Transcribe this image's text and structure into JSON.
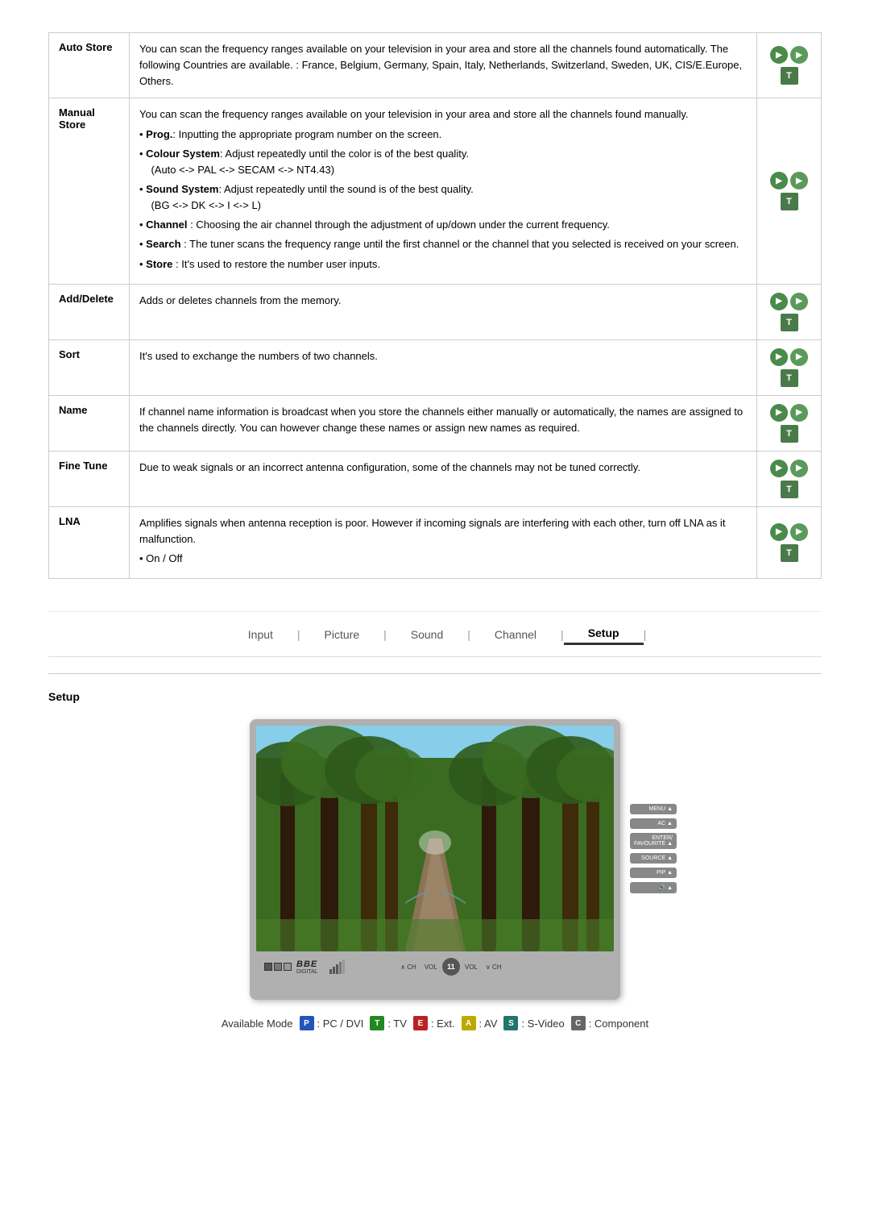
{
  "table": {
    "rows": [
      {
        "label": "Auto Store",
        "description": "You can scan the frequency ranges available on your television in your area and store all the channels found automatically. The following Countries are available.\n: France, Belgium, Germany, Spain, Italy, Netherlands, Switzerland, Sweden, UK, CIS/E.Europe, Others."
      },
      {
        "label": "Manual\nStore",
        "bullets": [
          "You can scan the frequency ranges available on your television in your area and store all the channels found manually.",
          "• Prog.: Inputting the appropriate program number on the screen.",
          "• Colour System: Adjust repeatedly until the color is of the best quality. (Auto <-> PAL <-> SECAM <-> NT4.43)",
          "• Sound System: Adjust repeatedly until the sound is of the best quality. (BG <-> DK <-> I <-> L)",
          "• Channel : Choosing the air channel through the adjustment of up/down under the current frequency.",
          "• Search : The tuner scans the frequency range until the first channel or the channel that you selected is received on your screen.",
          "• Store : It's used to restore the number user inputs."
        ]
      },
      {
        "label": "Add/Delete",
        "description": "Adds or deletes channels from the memory."
      },
      {
        "label": "Sort",
        "description": "It's used to exchange the numbers of two channels."
      },
      {
        "label": "Name",
        "description": "If channel name information is broadcast when you store the channels either manually or automatically, the names are assigned to the channels directly. You can however change these names or assign new names as required."
      },
      {
        "label": "Fine Tune",
        "description": "Due to weak signals or an incorrect antenna configuration, some of the channels may not be tuned correctly."
      },
      {
        "label": "LNA",
        "description": "Amplifies signals when antenna reception is poor. However if incoming signals are interfering with each other, turn off LNA as it malfunction.",
        "extra": "• On / Off"
      }
    ]
  },
  "navbar": {
    "items": [
      {
        "label": "Input",
        "active": false
      },
      {
        "label": "Picture",
        "active": false
      },
      {
        "label": "Sound",
        "active": false
      },
      {
        "label": "Channel",
        "active": false
      },
      {
        "label": "Setup",
        "active": true
      }
    ],
    "separator": "|"
  },
  "setup": {
    "title": "Setup"
  },
  "tv": {
    "logo": "BBE",
    "logo_sub": "DIGITAL",
    "right_buttons": [
      "MENU",
      "AC",
      "ENTER/\nFAVOURITE",
      "SOURCE",
      "PIP"
    ]
  },
  "mode_bar": {
    "label": "Available Mode",
    "modes": [
      {
        "icon": "P",
        "color": "badge-blue",
        "text": ": PC / DVI"
      },
      {
        "icon": "T",
        "color": "badge-green",
        "text": ": TV"
      },
      {
        "icon": "E",
        "color": "badge-red",
        "text": ": Ext."
      },
      {
        "icon": "A",
        "color": "badge-yellow",
        "text": ": AV"
      },
      {
        "icon": "S",
        "color": "badge-teal",
        "text": ": S-Video"
      },
      {
        "icon": "C",
        "color": "badge-gray",
        "text": ": Component"
      }
    ]
  }
}
